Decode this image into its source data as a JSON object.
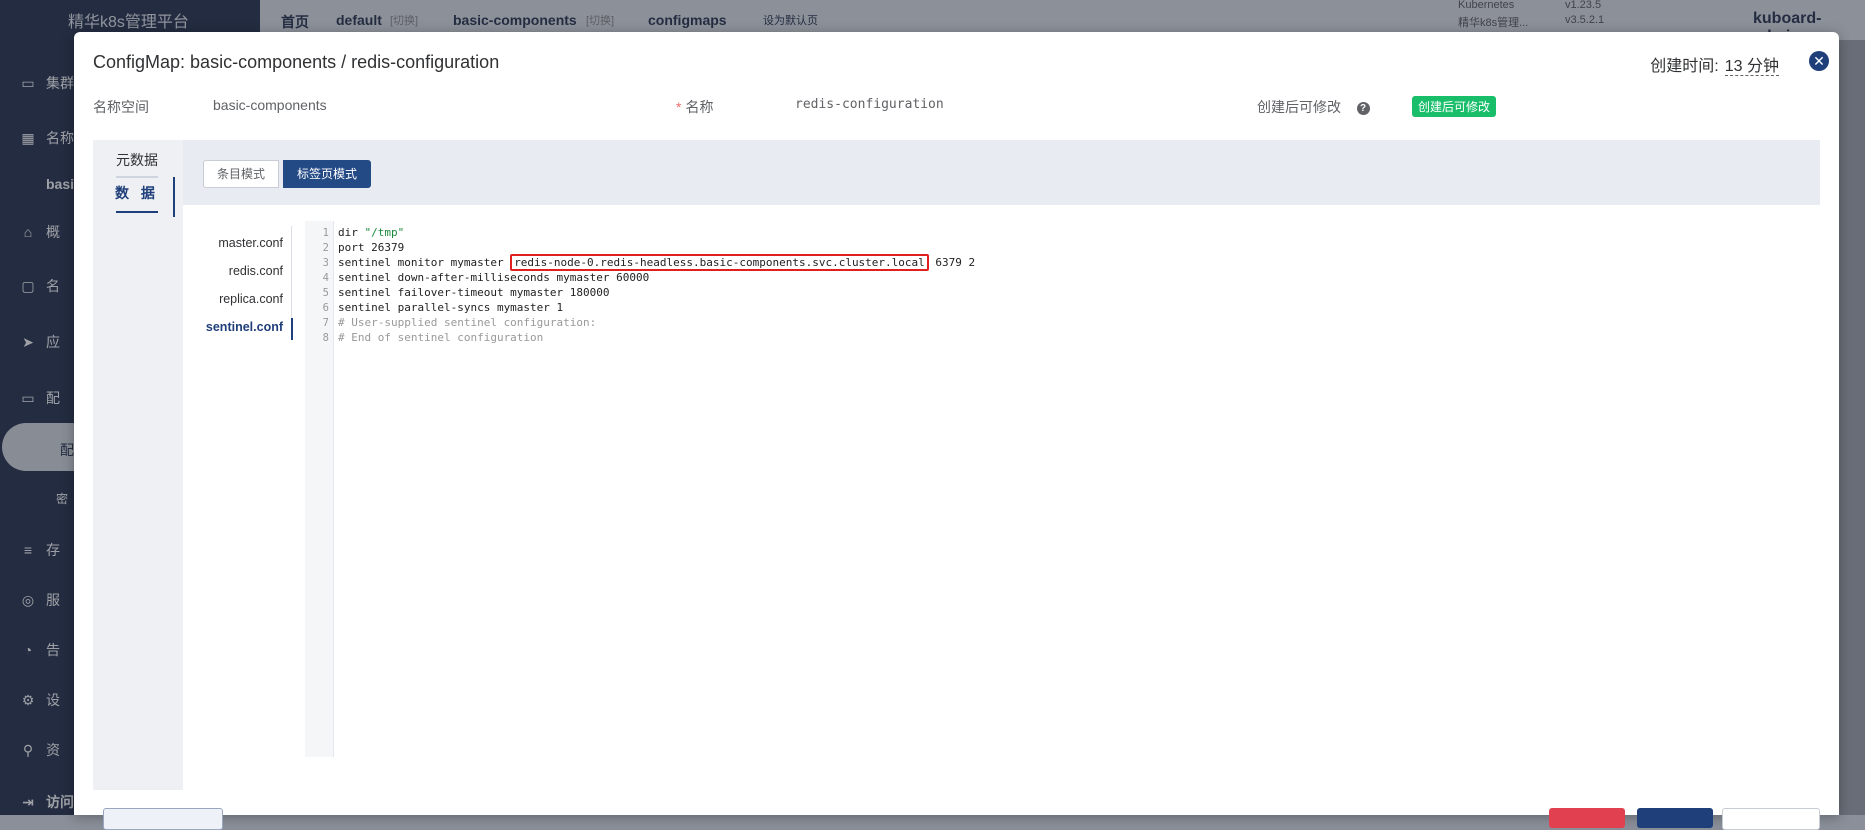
{
  "background": {
    "brand": "精华k8s管理平台",
    "nav_items": [
      "集群",
      "名称",
      "basic",
      "概",
      "名",
      "应",
      "配",
      "配",
      "密",
      "存",
      "服",
      "告",
      "设",
      "资",
      "访问"
    ],
    "breadcrumb": [
      "首页",
      "default",
      "[切换]",
      "basic-components",
      "[切换]",
      "configmaps",
      "设为默认页"
    ],
    "versions": [
      [
        "Kubernetes",
        "v1.23.5"
      ],
      [
        "精华k8s管理...",
        "v3.5.2.1"
      ]
    ],
    "user": "kuboard-admin"
  },
  "modal": {
    "title": "ConfigMap: basic-components / redis-configuration",
    "created_label": "创建时间:",
    "created_value": "13 分钟",
    "namespace_label": "名称空间",
    "namespace_value": "basic-components",
    "name_label": "名称",
    "name_value": "redis-configuration",
    "editable_label": "创建后可修改",
    "editable_tag": "创建后可修改",
    "left_tabs": [
      "元数据",
      "数 据"
    ],
    "mode_buttons": [
      "条目模式",
      "标签页模式"
    ],
    "files": [
      "master.conf",
      "redis.conf",
      "replica.conf",
      "sentinel.conf"
    ],
    "active_file": "sentinel.conf",
    "code_lines": [
      {
        "n": "1",
        "pre": "dir ",
        "str": "\"/tmp\"",
        "post": ""
      },
      {
        "n": "2",
        "pre": "port 26379",
        "str": "",
        "post": ""
      },
      {
        "n": "3",
        "pre": "sentinel monitor mymaster ",
        "hl": "redis-node-0.redis-headless.basic-components.svc.cluster.local",
        "post": " 6379 2"
      },
      {
        "n": "4",
        "pre": "sentinel down-after-milliseconds mymaster 60000"
      },
      {
        "n": "5",
        "pre": "sentinel failover-timeout mymaster 180000"
      },
      {
        "n": "6",
        "pre": "sentinel parallel-syncs mymaster 1"
      },
      {
        "n": "7",
        "comment": "# User-supplied sentinel configuration:"
      },
      {
        "n": "8",
        "comment": "# End of sentinel configuration"
      }
    ]
  },
  "colors": {
    "primary": "#1f3f7a",
    "highlight_border": "#e02020",
    "tag_green": "#19be6b"
  }
}
